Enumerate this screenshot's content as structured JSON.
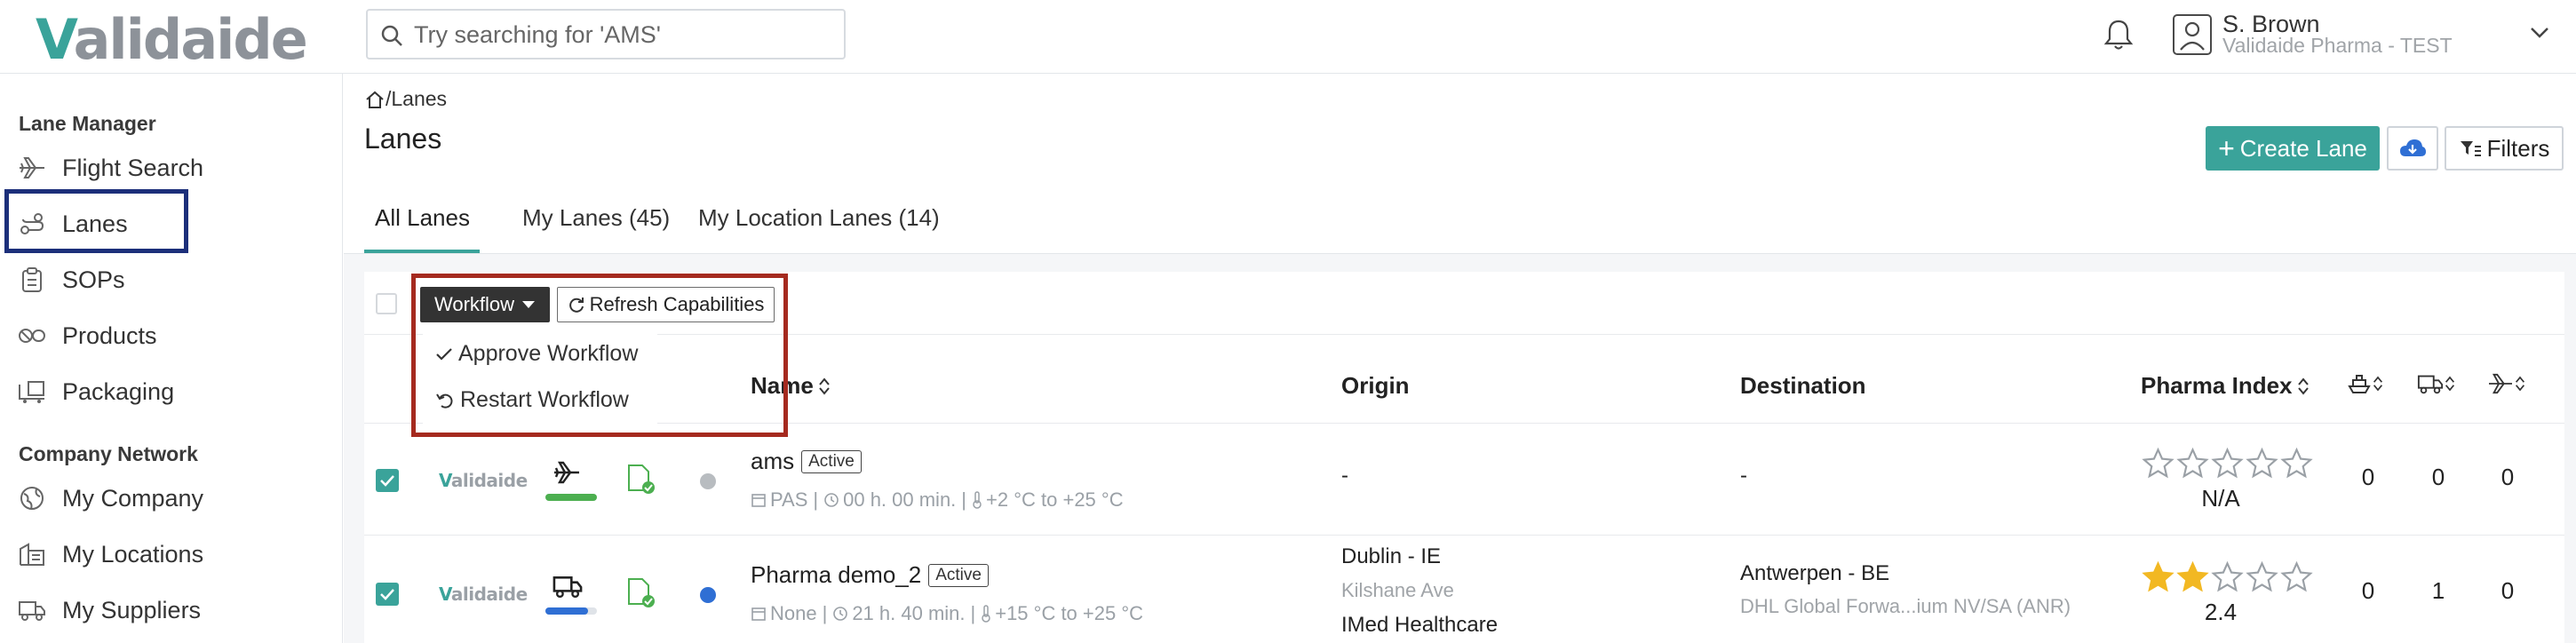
{
  "app": {
    "logo_text": "Validaide"
  },
  "search": {
    "placeholder": "Try searching for 'AMS'"
  },
  "user": {
    "name": "S. Brown",
    "org": "Validaide Pharma - TEST"
  },
  "sidebar": {
    "section1": "Lane Manager",
    "items1": [
      {
        "label": "Flight Search",
        "icon": "plane-icon"
      },
      {
        "label": "Lanes",
        "icon": "route-icon"
      },
      {
        "label": "SOPs",
        "icon": "clipboard-icon"
      },
      {
        "label": "Products",
        "icon": "pills-icon"
      },
      {
        "label": "Packaging",
        "icon": "pallet-icon"
      }
    ],
    "section2": "Company Network",
    "items2": [
      {
        "label": "My Company",
        "icon": "globe-icon"
      },
      {
        "label": "My Locations",
        "icon": "building-icon"
      },
      {
        "label": "My Suppliers",
        "icon": "truck-icon"
      }
    ]
  },
  "breadcrumb": {
    "home_icon": "home-icon",
    "sep": "/",
    "current": "Lanes"
  },
  "page": {
    "title": "Lanes"
  },
  "actions": {
    "create": "Create Lane",
    "filters": "Filters"
  },
  "tabs": [
    {
      "label": "All Lanes"
    },
    {
      "label": "My Lanes (45)"
    },
    {
      "label": "My Location Lanes (14)"
    }
  ],
  "toolbar": {
    "workflow": "Workflow",
    "refresh": "Refresh Capabilities"
  },
  "dropdown": {
    "items": [
      "Approve Workflow",
      "Restart Workflow"
    ]
  },
  "columns": {
    "name": "Name",
    "origin": "Origin",
    "destination": "Destination",
    "pharma_index": "Pharma Index"
  },
  "colors": {
    "accent": "#3aa39a",
    "dark": "#333333",
    "highlight_red": "#a52a1f",
    "nav_highlight": "#1c2f7a",
    "star": "#f2b823"
  },
  "rows": [
    {
      "logo": "Validaide",
      "transport": "plane-icon",
      "bar_color": "#4caf50",
      "status_dot": "#b8bcc0",
      "name": "ams",
      "status": "Active",
      "mode": "PAS",
      "duration": "00 h. 00 min.",
      "temp": "+2 °C to +25 °C",
      "origin_city": "-",
      "destination_city": "-",
      "rating": 0,
      "index": "N/A",
      "counts": [
        "0",
        "0",
        "0"
      ]
    },
    {
      "logo": "Validaide",
      "transport": "truck-icon",
      "bar_color": "#2f6fd4",
      "status_dot": "#2f6fd4",
      "name": "Pharma demo_2",
      "status": "Active",
      "mode": "None",
      "duration": "21 h. 40 min.",
      "temp": "+15 °C to +25 °C",
      "origin_city": "Dublin - IE",
      "origin_street": "Kilshane Ave",
      "origin_company": "IMed Healthcare",
      "destination_city": "Antwerpen - BE",
      "destination_company": "DHL Global Forwa...ium NV/SA (ANR)",
      "rating": 2,
      "index": "2.4",
      "counts": [
        "0",
        "1",
        "0"
      ]
    }
  ]
}
